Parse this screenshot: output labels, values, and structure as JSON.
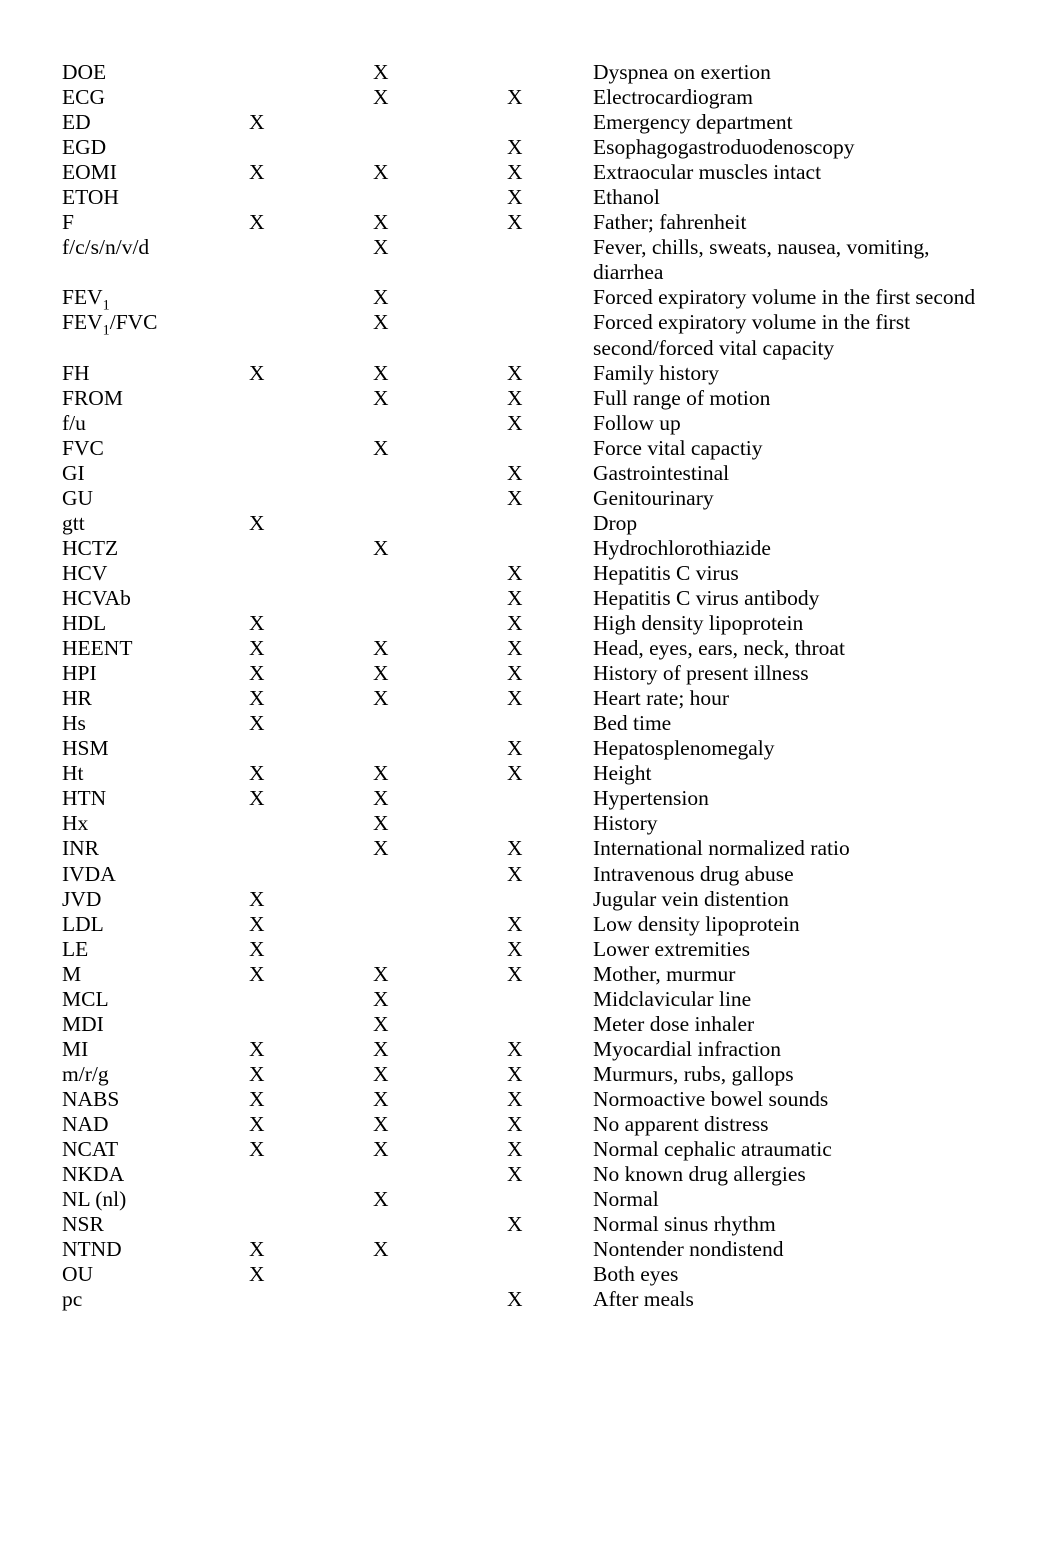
{
  "document": {
    "type": "medical-abbreviations-reference-list",
    "mark_symbol": "X",
    "column_count": 5,
    "text_color": "#000000",
    "background_color": "#ffffff"
  },
  "columns": [
    {
      "key": "abbreviation",
      "label": ""
    },
    {
      "key": "mark1",
      "label": ""
    },
    {
      "key": "mark2",
      "label": ""
    },
    {
      "key": "mark3",
      "label": ""
    },
    {
      "key": "definition",
      "label": ""
    }
  ],
  "rows": [
    {
      "abbr": "DOE",
      "abbr_sub": "",
      "abbr_suffix": "",
      "m1": "",
      "m2": "X",
      "m3": "",
      "def": "Dyspnea on exertion"
    },
    {
      "abbr": "ECG",
      "abbr_sub": "",
      "abbr_suffix": "",
      "m1": "",
      "m2": "X",
      "m3": "X",
      "def": "Electrocardiogram"
    },
    {
      "abbr": "ED",
      "abbr_sub": "",
      "abbr_suffix": "",
      "m1": "X",
      "m2": "",
      "m3": "",
      "def": "Emergency department"
    },
    {
      "abbr": "EGD",
      "abbr_sub": "",
      "abbr_suffix": "",
      "m1": "",
      "m2": "",
      "m3": "X",
      "def": "Esophagogastroduodenoscopy"
    },
    {
      "abbr": "EOMI",
      "abbr_sub": "",
      "abbr_suffix": "",
      "m1": "X",
      "m2": "X",
      "m3": "X",
      "def": "Extraocular muscles intact"
    },
    {
      "abbr": "ETOH",
      "abbr_sub": "",
      "abbr_suffix": "",
      "m1": "",
      "m2": "",
      "m3": "X",
      "def": "Ethanol"
    },
    {
      "abbr": "F",
      "abbr_sub": "",
      "abbr_suffix": "",
      "m1": "X",
      "m2": "X",
      "m3": "X",
      "def": "Father; fahrenheit"
    },
    {
      "abbr": "f/c/s/n/v/d",
      "abbr_sub": "",
      "abbr_suffix": "",
      "m1": "",
      "m2": "X",
      "m3": "",
      "def": "Fever, chills, sweats, nausea, vomiting, diarrhea"
    },
    {
      "abbr": "FEV",
      "abbr_sub": "1",
      "abbr_suffix": "",
      "m1": "",
      "m2": "X",
      "m3": "",
      "def": "Forced expiratory volume in the first second"
    },
    {
      "abbr": "FEV",
      "abbr_sub": "1",
      "abbr_suffix": "/FVC",
      "m1": "",
      "m2": "X",
      "m3": "",
      "def": "Forced expiratory volume in the first second/forced vital capacity"
    },
    {
      "abbr": "FH",
      "abbr_sub": "",
      "abbr_suffix": "",
      "m1": "X",
      "m2": "X",
      "m3": "X",
      "def": "Family history"
    },
    {
      "abbr": "FROM",
      "abbr_sub": "",
      "abbr_suffix": "",
      "m1": "",
      "m2": "X",
      "m3": "X",
      "def": "Full range of motion"
    },
    {
      "abbr": "f/u",
      "abbr_sub": "",
      "abbr_suffix": "",
      "m1": "",
      "m2": "",
      "m3": "X",
      "def": "Follow up"
    },
    {
      "abbr": "FVC",
      "abbr_sub": "",
      "abbr_suffix": "",
      "m1": "",
      "m2": "X",
      "m3": "",
      "def": "Force vital capactiy"
    },
    {
      "abbr": "GI",
      "abbr_sub": "",
      "abbr_suffix": "",
      "m1": "",
      "m2": "",
      "m3": "X",
      "def": "Gastrointestinal"
    },
    {
      "abbr": "GU",
      "abbr_sub": "",
      "abbr_suffix": "",
      "m1": "",
      "m2": "",
      "m3": "X",
      "def": "Genitourinary"
    },
    {
      "abbr": "gtt",
      "abbr_sub": "",
      "abbr_suffix": "",
      "m1": "X",
      "m2": "",
      "m3": "",
      "def": "Drop"
    },
    {
      "abbr": "HCTZ",
      "abbr_sub": "",
      "abbr_suffix": "",
      "m1": "",
      "m2": "X",
      "m3": "",
      "def": "Hydrochlorothiazide"
    },
    {
      "abbr": "HCV",
      "abbr_sub": "",
      "abbr_suffix": "",
      "m1": "",
      "m2": "",
      "m3": "X",
      "def": "Hepatitis C virus"
    },
    {
      "abbr": "HCVAb",
      "abbr_sub": "",
      "abbr_suffix": "",
      "m1": "",
      "m2": "",
      "m3": "X",
      "def": "Hepatitis C virus antibody"
    },
    {
      "abbr": "HDL",
      "abbr_sub": "",
      "abbr_suffix": "",
      "m1": "X",
      "m2": "",
      "m3": "X",
      "def": "High density lipoprotein"
    },
    {
      "abbr": "HEENT",
      "abbr_sub": "",
      "abbr_suffix": "",
      "m1": "X",
      "m2": "X",
      "m3": "X",
      "def": "Head, eyes, ears, neck, throat"
    },
    {
      "abbr": "HPI",
      "abbr_sub": "",
      "abbr_suffix": "",
      "m1": "X",
      "m2": "X",
      "m3": "X",
      "def": "History of present illness"
    },
    {
      "abbr": "HR",
      "abbr_sub": "",
      "abbr_suffix": "",
      "m1": "X",
      "m2": "X",
      "m3": "X",
      "def": "Heart rate; hour"
    },
    {
      "abbr": "Hs",
      "abbr_sub": "",
      "abbr_suffix": "",
      "m1": "X",
      "m2": "",
      "m3": "",
      "def": "Bed time"
    },
    {
      "abbr": "HSM",
      "abbr_sub": "",
      "abbr_suffix": "",
      "m1": "",
      "m2": "",
      "m3": "X",
      "def": "Hepatosplenomegaly"
    },
    {
      "abbr": "Ht",
      "abbr_sub": "",
      "abbr_suffix": "",
      "m1": "X",
      "m2": "X",
      "m3": "X",
      "def": "Height"
    },
    {
      "abbr": "HTN",
      "abbr_sub": "",
      "abbr_suffix": "",
      "m1": "X",
      "m2": "X",
      "m3": "",
      "def": "Hypertension"
    },
    {
      "abbr": "Hx",
      "abbr_sub": "",
      "abbr_suffix": "",
      "m1": "",
      "m2": "X",
      "m3": "",
      "def": "History"
    },
    {
      "abbr": "INR",
      "abbr_sub": "",
      "abbr_suffix": "",
      "m1": "",
      "m2": "X",
      "m3": "X",
      "def": "International normalized ratio"
    },
    {
      "abbr": "IVDA",
      "abbr_sub": "",
      "abbr_suffix": "",
      "m1": "",
      "m2": "",
      "m3": "X",
      "def": "Intravenous drug abuse"
    },
    {
      "abbr": "JVD",
      "abbr_sub": "",
      "abbr_suffix": "",
      "m1": "X",
      "m2": "",
      "m3": "",
      "def": "Jugular vein distention"
    },
    {
      "abbr": "LDL",
      "abbr_sub": "",
      "abbr_suffix": "",
      "m1": "X",
      "m2": "",
      "m3": "X",
      "def": "Low density lipoprotein"
    },
    {
      "abbr": "LE",
      "abbr_sub": "",
      "abbr_suffix": "",
      "m1": "X",
      "m2": "",
      "m3": "X",
      "def": "Lower extremities"
    },
    {
      "abbr": "M",
      "abbr_sub": "",
      "abbr_suffix": "",
      "m1": "X",
      "m2": "X",
      "m3": "X",
      "def": "Mother, murmur"
    },
    {
      "abbr": "MCL",
      "abbr_sub": "",
      "abbr_suffix": "",
      "m1": "",
      "m2": "X",
      "m3": "",
      "def": "Midclavicular line"
    },
    {
      "abbr": "MDI",
      "abbr_sub": "",
      "abbr_suffix": "",
      "m1": "",
      "m2": "X",
      "m3": "",
      "def": "Meter dose inhaler"
    },
    {
      "abbr": "MI",
      "abbr_sub": "",
      "abbr_suffix": "",
      "m1": "X",
      "m2": "X",
      "m3": "X",
      "def": "Myocardial infraction"
    },
    {
      "abbr": "m/r/g",
      "abbr_sub": "",
      "abbr_suffix": "",
      "m1": "X",
      "m2": "X",
      "m3": "X",
      "def": "Murmurs, rubs, gallops"
    },
    {
      "abbr": "NABS",
      "abbr_sub": "",
      "abbr_suffix": "",
      "m1": "X",
      "m2": "X",
      "m3": "X",
      "def": "Normoactive bowel sounds"
    },
    {
      "abbr": "NAD",
      "abbr_sub": "",
      "abbr_suffix": "",
      "m1": "X",
      "m2": "X",
      "m3": "X",
      "def": "No apparent distress"
    },
    {
      "abbr": "NCAT",
      "abbr_sub": "",
      "abbr_suffix": "",
      "m1": "X",
      "m2": "X",
      "m3": "X",
      "def": "Normal cephalic atraumatic"
    },
    {
      "abbr": "NKDA",
      "abbr_sub": "",
      "abbr_suffix": "",
      "m1": "",
      "m2": "",
      "m3": "X",
      "def": "No known drug allergies"
    },
    {
      "abbr": "NL (nl)",
      "abbr_sub": "",
      "abbr_suffix": "",
      "m1": "",
      "m2": "X",
      "m3": "",
      "def": "Normal"
    },
    {
      "abbr": "NSR",
      "abbr_sub": "",
      "abbr_suffix": "",
      "m1": "",
      "m2": "",
      "m3": "X",
      "def": "Normal sinus rhythm"
    },
    {
      "abbr": "NTND",
      "abbr_sub": "",
      "abbr_suffix": "",
      "m1": "X",
      "m2": "X",
      "m3": "",
      "def": "Nontender nondistend"
    },
    {
      "abbr": "OU",
      "abbr_sub": "",
      "abbr_suffix": "",
      "m1": "X",
      "m2": "",
      "m3": "",
      "def": "Both eyes"
    },
    {
      "abbr": "pc",
      "abbr_sub": "",
      "abbr_suffix": "",
      "m1": "",
      "m2": "",
      "m3": "X",
      "def": "After meals"
    }
  ]
}
